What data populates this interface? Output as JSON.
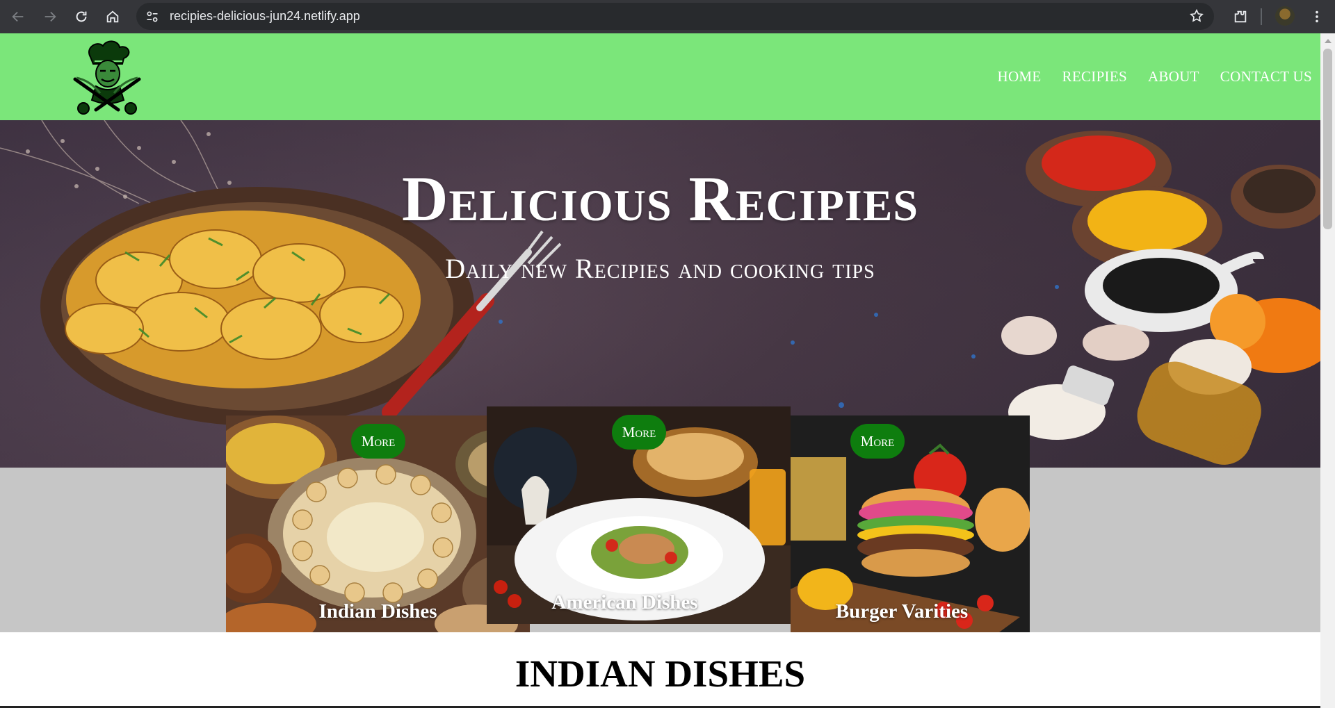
{
  "browser": {
    "url": "recipies-delicious-jun24.netlify.app",
    "icons": [
      "back-icon",
      "forward-icon",
      "reload-icon",
      "home-icon",
      "site-info-icon",
      "star-icon",
      "extensions-icon",
      "profile-avatar",
      "menu-icon"
    ]
  },
  "header": {
    "logo": "chef-logo",
    "nav": [
      "HOME",
      "RECIPIES",
      "ABOUT",
      "CONTACT US"
    ]
  },
  "hero": {
    "title": "Delicious Recipies",
    "subtitle": "Daily new Recipies and cooking tips"
  },
  "cards": [
    {
      "label": "Indian Dishes",
      "button": "More"
    },
    {
      "label": "American Dishes",
      "button": "More"
    },
    {
      "label": "Burger Varities",
      "button": "More"
    }
  ],
  "section": {
    "title": "INDIAN DISHES"
  },
  "colors": {
    "header_bg": "#7be67a",
    "button_green": "#0e7d0e",
    "band_grey": "#c6c6c6"
  }
}
